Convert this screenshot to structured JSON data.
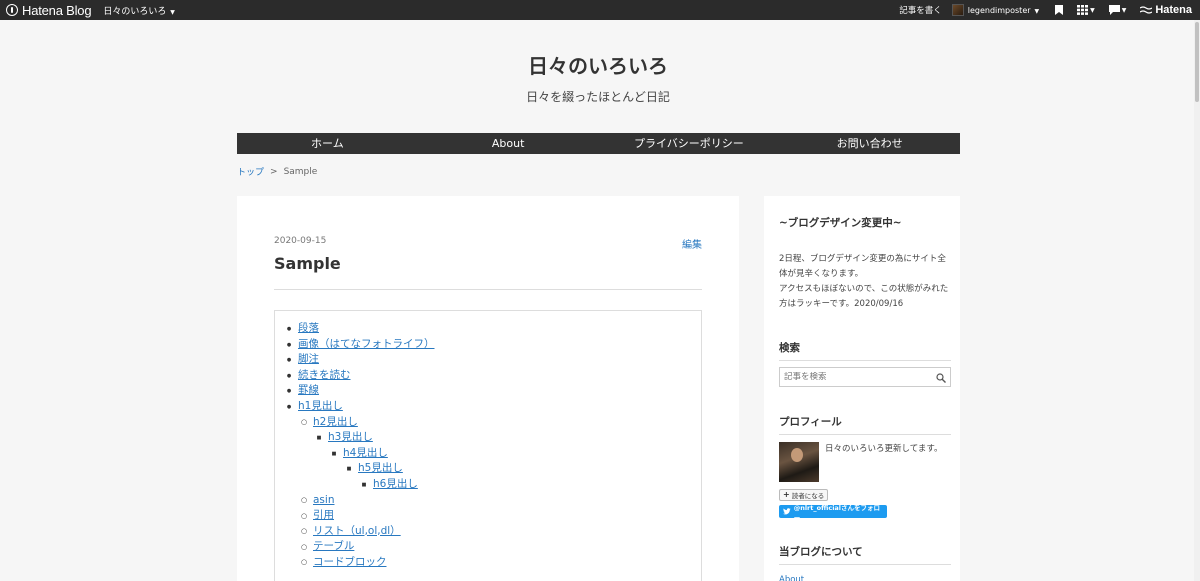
{
  "globalbar": {
    "logo_text": "Hatena Blog",
    "blog_name": "日々のいろいろ",
    "write_label": "記事を書く",
    "username": "legendimposter",
    "hatena_label": "Hatena"
  },
  "header": {
    "title": "日々のいろいろ",
    "description": "日々を綴ったほとんど日記"
  },
  "nav": {
    "items": [
      {
        "label": "ホーム"
      },
      {
        "label": "About"
      },
      {
        "label": "プライバシーポリシー"
      },
      {
        "label": "お問い合わせ"
      }
    ]
  },
  "breadcrumb": {
    "top": "トップ",
    "separator": ">",
    "current": "Sample"
  },
  "entry": {
    "date": "2020-09-15",
    "edit_label": "編集",
    "title": "Sample",
    "toc": [
      {
        "label": "段落",
        "level": 0
      },
      {
        "label": "画像（はてなフォトライフ）",
        "level": 0
      },
      {
        "label": "脚注",
        "level": 0
      },
      {
        "label": "続きを読む",
        "level": 0
      },
      {
        "label": "罫線",
        "level": 0
      },
      {
        "label": "h1見出し",
        "level": 0
      },
      {
        "label": "h2見出し",
        "level": 1
      },
      {
        "label": "h3見出し",
        "level": 2
      },
      {
        "label": "h4見出し",
        "level": 3
      },
      {
        "label": "h5見出し",
        "level": 4
      },
      {
        "label": "h6見出し",
        "level": 5
      },
      {
        "label": "asin",
        "level": 1
      },
      {
        "label": "引用",
        "level": 1
      },
      {
        "label": "リスト（ul,ol,dl）",
        "level": 1
      },
      {
        "label": "テーブル",
        "level": 1
      },
      {
        "label": "コードブロック",
        "level": 1
      }
    ]
  },
  "sidebar": {
    "notice": {
      "title": "~ブログデザイン変更中~",
      "body": [
        "2日程、ブログデザイン変更の為にサイト全体が見辛くなります。",
        "アクセスもほぼないので、この状態がみれた方はラッキーです。2020/09/16"
      ]
    },
    "search": {
      "title": "検索",
      "placeholder": "記事を検索"
    },
    "profile": {
      "title": "プロフィール",
      "text": "日々のいろいろ更新してます。",
      "reader_label": "読者になる",
      "twitter_label": "@nlrt_officialさんをフォロー"
    },
    "about": {
      "title": "当ブログについて",
      "link": "About"
    }
  },
  "colors": {
    "globalbar_bg": "#2b2b2b",
    "nav_bg": "#333333",
    "link": "#2878c0",
    "twitter": "#1d9bf0"
  }
}
